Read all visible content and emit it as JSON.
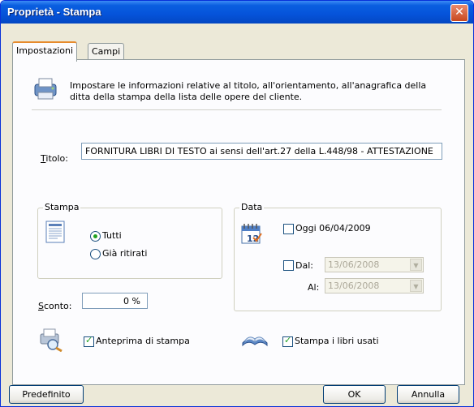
{
  "window": {
    "title": "Proprietà - Stampa",
    "close_glyph": "✕"
  },
  "tabs": [
    {
      "label": "Impostazioni",
      "active": true
    },
    {
      "label": "Campi",
      "active": false
    }
  ],
  "description": "Impostare le informazioni relative al titolo, all'orientamento, all'anagrafica della ditta della stampa della lista delle opere del cliente.",
  "titolo": {
    "label_key": "T",
    "label_rest": "itolo:",
    "value": "FORNITURA LIBRI DI TESTO ai sensi dell'art.27 della L.448/98 - ATTESTAZIONE"
  },
  "stampa": {
    "legend": "Stampa",
    "options": [
      {
        "label": "Tutti",
        "selected": true
      },
      {
        "label": "Già ritirati",
        "selected": false
      }
    ]
  },
  "data": {
    "legend": "Data",
    "oggi_label": "Oggi 06/04/2009",
    "oggi_checked": false,
    "dal_label": "Dal:",
    "dal_checked": false,
    "dal_value": "13/06/2008",
    "al_label": "Al:",
    "al_value": "13/06/2008"
  },
  "sconto": {
    "label_key": "S",
    "label_rest": "conto:",
    "value": "0 %"
  },
  "anteprima": {
    "label": "Anteprima di stampa",
    "checked": true
  },
  "libri_usati": {
    "label": "Stampa i libri usati",
    "checked": true
  },
  "buttons": {
    "default": "Predefinito",
    "ok": "OK",
    "cancel": "Annulla"
  },
  "icons": [
    "printer-info-icon",
    "document-icon",
    "calendar-icon",
    "print-preview-icon",
    "open-book-icon",
    "close-icon",
    "combo-arrow-icon"
  ],
  "colors": {
    "titlebar": "#0553da",
    "face": "#ece9d8",
    "tab_highlight": "#e68b2c",
    "check": "#21a121"
  }
}
